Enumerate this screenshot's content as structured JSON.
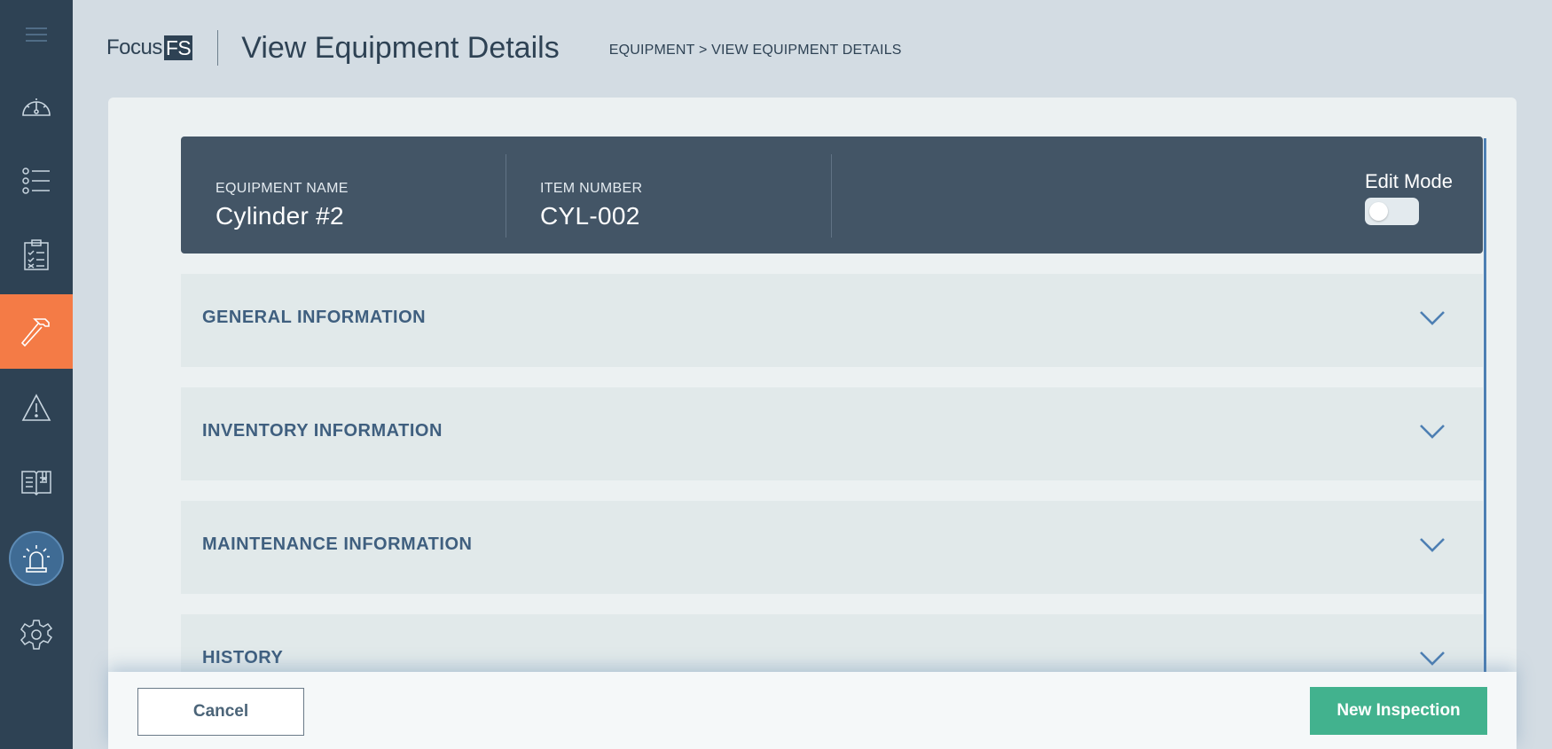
{
  "sidebar": {
    "items": [
      {
        "icon": "hamburger-menu-icon"
      },
      {
        "icon": "dashboard-gauge-icon"
      },
      {
        "icon": "list-icon"
      },
      {
        "icon": "checklist-clipboard-icon"
      },
      {
        "icon": "hammer-icon",
        "active": true
      },
      {
        "icon": "warning-icon"
      },
      {
        "icon": "book-icon"
      },
      {
        "icon": "alarm-light-icon"
      },
      {
        "icon": "gear-icon"
      }
    ],
    "active_color": "#f47b46"
  },
  "header": {
    "logo_text": "Focus",
    "logo_box_text": "FS",
    "title": "View Equipment Details",
    "breadcrumb": "EQUIPMENT > VIEW EQUIPMENT DETAILS"
  },
  "equipment": {
    "name_label": "EQUIPMENT NAME",
    "name_value": "Cylinder #2",
    "item_label": "ITEM NUMBER",
    "item_value": "CYL-002",
    "edit_mode_label": "Edit Mode",
    "edit_mode_on": false
  },
  "sections": [
    {
      "title": "GENERAL INFORMATION"
    },
    {
      "title": "INVENTORY INFORMATION"
    },
    {
      "title": "MAINTENANCE INFORMATION"
    },
    {
      "title": "HISTORY"
    }
  ],
  "footer": {
    "cancel_label": "Cancel",
    "primary_label": "New Inspection",
    "primary_color": "#42b28e"
  }
}
